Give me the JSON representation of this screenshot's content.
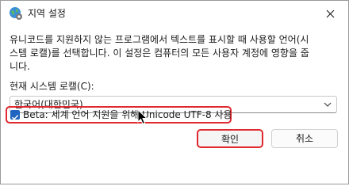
{
  "window": {
    "title": "지역 설정",
    "icon": "globe-settings-icon",
    "close_icon": "close-icon"
  },
  "description": {
    "line1": "유니코드를 지원하지 않는 프로그램에서 텍스트를 표시할 때 사용할 언어(시",
    "line2": "스템 로캘)를 선택합니다. 이 설정은 컴퓨터의 모든 사용자 계정에 영향을 줍",
    "line3": "니다."
  },
  "locale": {
    "label": "현재 시스템 로캘(C):",
    "selected": "한국어(대한민국)",
    "chevron_icon": "chevron-down-icon"
  },
  "beta_option": {
    "label": "Beta: 세계 언어 지원을 위해 Unicode UTF-8 사용",
    "checked": true,
    "checkbox_color": "#1f64c0",
    "highlight_color": "#e0282e"
  },
  "buttons": {
    "ok_label": "확인",
    "cancel_label": "취소"
  }
}
